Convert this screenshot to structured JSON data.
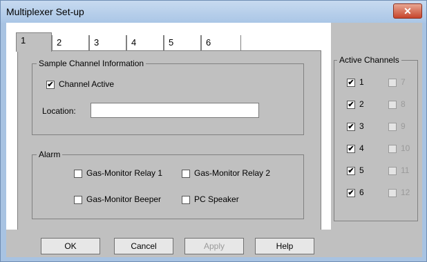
{
  "window": {
    "title": "Multiplexer Set-up",
    "close_symbol": "✕"
  },
  "tabs": [
    "1",
    "2",
    "3",
    "4",
    "5",
    "6"
  ],
  "sample_group": {
    "title": "Sample Channel Information",
    "channel_active_label": "Channel Active",
    "channel_active_checked": true,
    "location_label": "Location:",
    "location_value": ""
  },
  "alarm_group": {
    "title": "Alarm",
    "items": [
      {
        "label": "Gas-Monitor Relay 1",
        "checked": false
      },
      {
        "label": "Gas-Monitor Relay 2",
        "checked": false
      },
      {
        "label": "Gas-Monitor Beeper",
        "checked": false
      },
      {
        "label": "PC Speaker",
        "checked": false
      }
    ]
  },
  "active_channels": {
    "title": "Active Channels",
    "left": [
      {
        "label": "1",
        "checked": true
      },
      {
        "label": "2",
        "checked": true
      },
      {
        "label": "3",
        "checked": true
      },
      {
        "label": "4",
        "checked": true
      },
      {
        "label": "5",
        "checked": true
      },
      {
        "label": "6",
        "checked": true
      }
    ],
    "right": [
      {
        "label": "7",
        "checked": false,
        "disabled": true
      },
      {
        "label": "8",
        "checked": false,
        "disabled": true
      },
      {
        "label": "9",
        "checked": false,
        "disabled": true
      },
      {
        "label": "10",
        "checked": false,
        "disabled": true
      },
      {
        "label": "11",
        "checked": false,
        "disabled": true
      },
      {
        "label": "12",
        "checked": false,
        "disabled": true
      }
    ]
  },
  "buttons": {
    "ok": "OK",
    "cancel": "Cancel",
    "apply": "Apply",
    "help": "Help"
  }
}
